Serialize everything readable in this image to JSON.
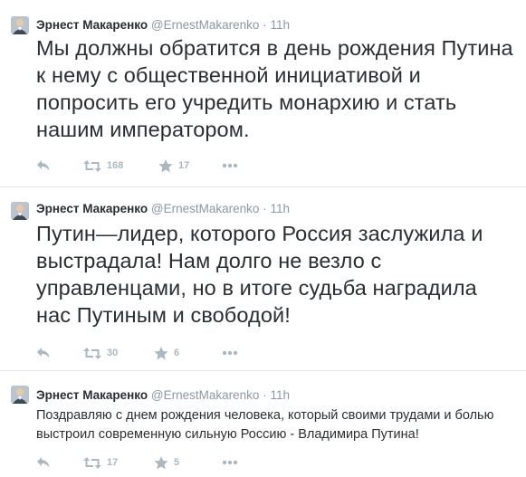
{
  "colors": {
    "name": "#292f33",
    "meta": "#8899a6",
    "action_icon": "#aab8c2",
    "divider": "#e1e8ed"
  },
  "tweets": [
    {
      "author_name": "Эрнест Макаренко",
      "handle": "@ErnestMakarenko",
      "separator": "·",
      "time": "11h",
      "text": "Мы должны обратится в день рождения Путина к нему с общественной инициативой и попросить его учредить монархию и стать нашим императором.",
      "retweets": "168",
      "favorites": "17",
      "icons": [
        "reply-icon",
        "retweet-icon",
        "favorite-icon",
        "more-icon"
      ]
    },
    {
      "author_name": "Эрнест Макаренко",
      "handle": "@ErnestMakarenko",
      "separator": "·",
      "time": "11h",
      "text": "Путин—лидер, которого Россия заслужила и выстрадала! Нам долго не везло с управленцами, но в итоге судьба наградила нас Путиным и свободой!",
      "retweets": "30",
      "favorites": "6",
      "icons": [
        "reply-icon",
        "retweet-icon",
        "favorite-icon",
        "more-icon"
      ]
    },
    {
      "author_name": "Эрнест Макаренко",
      "handle": "@ErnestMakarenko",
      "separator": "·",
      "time": "11h",
      "text": "Поздравляю с днем рождения человека, который своими трудами и болью выстроил современную сильную Россию - Владимира Путина!",
      "retweets": "17",
      "favorites": "5",
      "icons": [
        "reply-icon",
        "retweet-icon",
        "favorite-icon",
        "more-icon"
      ]
    }
  ]
}
